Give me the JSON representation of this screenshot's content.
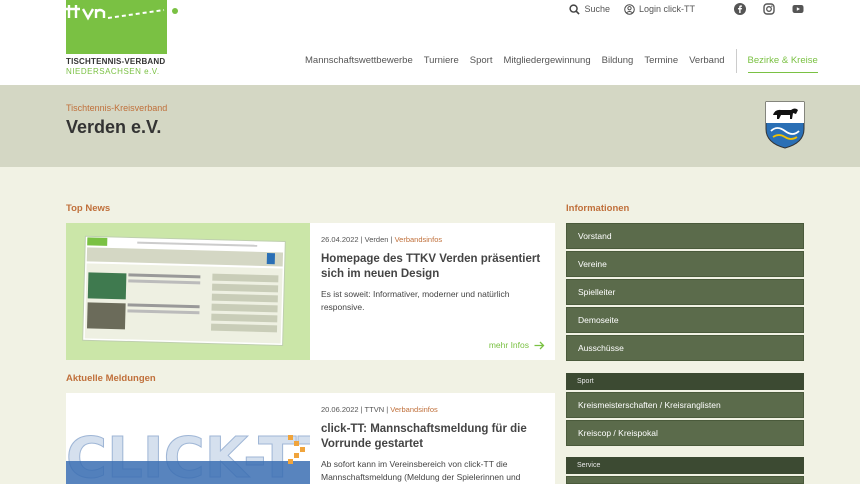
{
  "logo": {
    "line1": "TISCHTENNIS-VERBAND",
    "line2": "NIEDERSACHSEN e.V."
  },
  "topbar": {
    "search_label": "Suche",
    "login_label": "Login click-TT",
    "social_icons": [
      "facebook-icon",
      "instagram-icon",
      "youtube-icon"
    ]
  },
  "nav": {
    "items": [
      "Mannschaftswettbewerbe",
      "Turniere",
      "Sport",
      "Mitgliedergewinnung",
      "Bildung",
      "Termine",
      "Verband"
    ],
    "active": "Bezirke & Kreise"
  },
  "banner": {
    "subtitle": "Tischtennis-Kreisverband",
    "title": "Verden e.V."
  },
  "top_news": {
    "heading": "Top News",
    "date": "26.04.2022",
    "source": "Verden",
    "category": "Verbandsinfos",
    "title": "Homepage des TTKV Verden präsentiert sich im neuen Design",
    "text": "Es ist soweit: Informativer, moderner und natürlich responsive.",
    "more": "mehr Infos"
  },
  "aktuelle": {
    "heading": "Aktuelle Meldungen",
    "date": "20.06.2022",
    "source": "TTVN",
    "category": "Verbandsinfos",
    "title": "click-TT: Mannschaftsmeldung für die Vorrunde gestartet",
    "text": "Ab sofort kann im Vereinsbereich von click-TT die Mannschaftsmeldung (Meldung der Spielerinnen und"
  },
  "sidebar": {
    "heading": "Informationen",
    "items": [
      "Vorstand",
      "Vereine",
      "Spielleiter",
      "Demoseite",
      "Ausschüsse"
    ],
    "sport_label": "Sport",
    "sport_items": [
      "Kreismeisterschaften / Kreisranglisten",
      "Kreiscop / Kreispokal"
    ],
    "service_label": "Service"
  },
  "colors": {
    "brand_green": "#7ac143",
    "accent_orange": "#c0703b",
    "sidebar_button": "#5b6b4b",
    "sidebar_category": "#3c4a32"
  }
}
